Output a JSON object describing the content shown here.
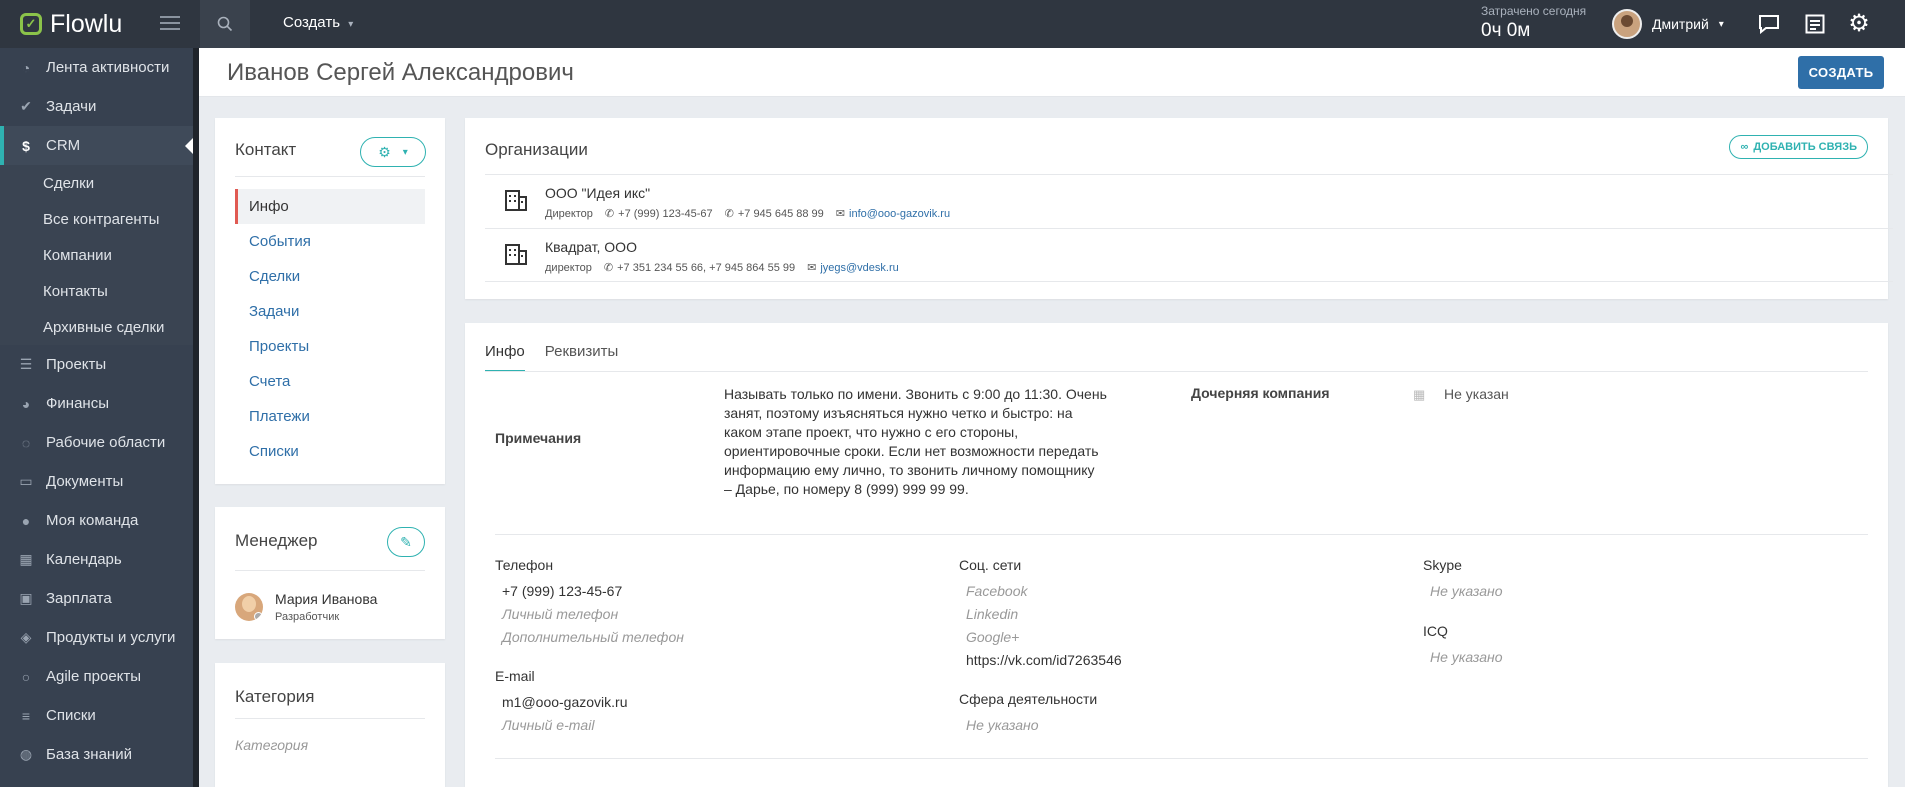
{
  "app": {
    "name": "Flowlu",
    "create_label": "Создать",
    "spent_label": "Затрачено сегодня",
    "spent_value": "0ч 0м",
    "user_name": "Дмитрий"
  },
  "sidebar": {
    "items": [
      {
        "label": "Лента активности",
        "icon": "rss-icon"
      },
      {
        "label": "Задачи",
        "icon": "check-icon"
      },
      {
        "label": "CRM",
        "icon": "dollar-icon"
      }
    ],
    "crm_sub": [
      "Сделки",
      "Все контрагенты",
      "Компании",
      "Контакты",
      "Архивные сделки"
    ],
    "items2": [
      {
        "label": "Проекты",
        "icon": "projects-icon"
      },
      {
        "label": "Финансы",
        "icon": "pie-icon"
      },
      {
        "label": "Рабочие области",
        "icon": "chat-icon"
      },
      {
        "label": "Документы",
        "icon": "folder-icon"
      },
      {
        "label": "Моя команда",
        "icon": "team-icon"
      },
      {
        "label": "Календарь",
        "icon": "calendar-icon"
      },
      {
        "label": "Зарплата",
        "icon": "money-icon"
      },
      {
        "label": "Продукты и услуги",
        "icon": "box-icon"
      },
      {
        "label": "Agile проекты",
        "icon": "circle-icon"
      },
      {
        "label": "Списки",
        "icon": "list-icon"
      },
      {
        "label": "База знаний",
        "icon": "globe-icon"
      }
    ]
  },
  "page": {
    "title": "Иванов Сергей Александрович",
    "create_button": "СОЗДАТЬ"
  },
  "contact_card": {
    "title": "Контакт",
    "nav": [
      "Инфо",
      "События",
      "Сделки",
      "Задачи",
      "Проекты",
      "Счета",
      "Платежи",
      "Списки"
    ]
  },
  "manager_card": {
    "title": "Менеджер",
    "name": "Мария Иванова",
    "role": "Разработчик"
  },
  "category_card": {
    "title": "Категория",
    "placeholder": "Категория"
  },
  "orgs": {
    "title": "Организации",
    "add_link": "ДОБАВИТЬ СВЯЗЬ",
    "rows": [
      {
        "name": "ООО \"Идея икс\"",
        "role": "Директор",
        "phone1": "+7 (999) 123-45-67",
        "phone2": "+7 945 645 88 99",
        "email": "info@ooo-gazovik.ru"
      },
      {
        "name": "Квадрат, ООО",
        "role": "директор",
        "phone1": "+7 351 234 55 66, +7 945 864 55 99",
        "phone2": "",
        "email": "jyegs@vdesk.ru"
      }
    ]
  },
  "info": {
    "tabs": [
      "Инфо",
      "Реквизиты"
    ],
    "notes_label": "Примечания",
    "notes_lines": [
      "Называть только по имени. Звонить с 9:00 до 11:30. Очень",
      "занят, поэтому изъясняться нужно четко и быстро: на",
      "каком этапе проект, что нужно с его стороны,",
      "ориентировочные сроки. Если нет возможности передать",
      "информацию ему лично, то звонить личному помощнику",
      "– Дарье, по номеру 8 (999) 999 99 99."
    ],
    "subsidiary_label": "Дочерняя компания",
    "subsidiary_value": "Не указан",
    "phone_label": "Телефон",
    "phone_value": "+7 (999) 123-45-67",
    "phone_ph1": "Личный телефон",
    "phone_ph2": "Дополнительный телефон",
    "email_label": "E-mail",
    "email_value": "m1@ooo-gazovik.ru",
    "email_ph": "Личный e-mail",
    "social_label": "Соц. сети",
    "social_fb": "Facebook",
    "social_li": "Linkedin",
    "social_gp": "Google+",
    "social_vk": "https://vk.com/id7263546",
    "sphere_label": "Сфера деятельности",
    "sphere_value": "Не указано",
    "skype_label": "Skype",
    "skype_value": "Не указано",
    "icq_label": "ICQ",
    "icq_value": "Не указано"
  }
}
